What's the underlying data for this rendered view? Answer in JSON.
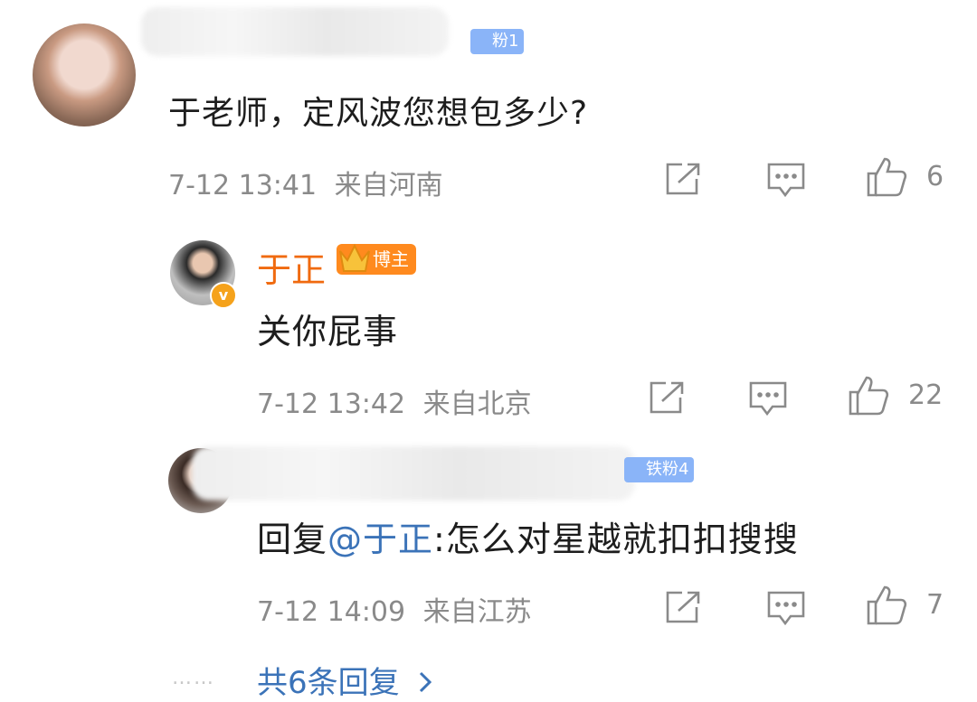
{
  "comments": [
    {
      "badge": "粉1",
      "text": "于老师，定风波您想包多少?",
      "time": "7-12 13:41",
      "location": "来自河南",
      "likes": "6"
    },
    {
      "username": "于正",
      "badge": "博主",
      "text": "关你屁事",
      "time": "7-12 13:42",
      "location": "来自北京",
      "likes": "22"
    },
    {
      "badge": "铁粉4",
      "reply_prefix": "回复",
      "mention": "@于正",
      "text": ":怎么对星越就扣扣搜搜",
      "time": "7-12 14:09",
      "location": "来自江苏",
      "likes": "7"
    }
  ],
  "more_replies": "共6条回复",
  "more_dots": "……",
  "icons": {
    "share": "share-icon",
    "comment": "comment-icon",
    "like": "thumbs-up-icon",
    "verified": "verified-v-icon",
    "chevron": "chevron-right-icon"
  },
  "colors": {
    "accent_orange": "#f06a0f",
    "link_blue": "#3b73b8",
    "meta_gray": "#8a8a8a"
  }
}
